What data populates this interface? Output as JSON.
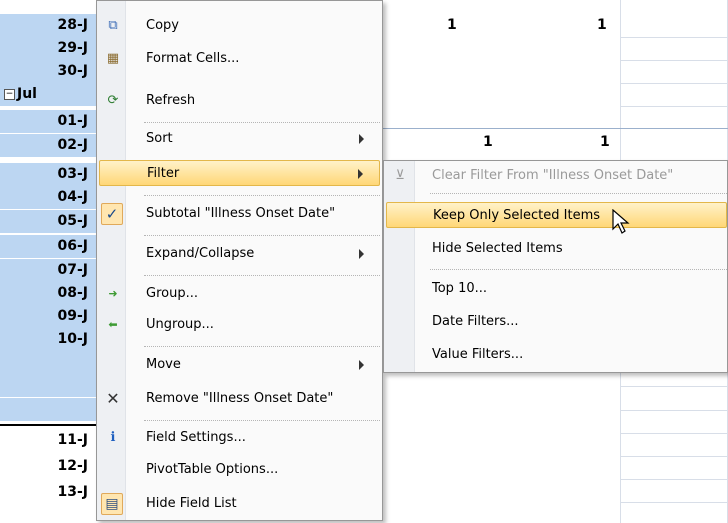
{
  "sheet": {
    "rows": [
      {
        "label": "28-J",
        "selected": true
      },
      {
        "label": "29-J",
        "selected": true
      },
      {
        "label": "30-J",
        "selected": true
      },
      {
        "label": "Jul",
        "selected": true,
        "group": true,
        "expander": "−"
      },
      {
        "label": "01-J",
        "selected": true
      },
      {
        "label": "02-J",
        "selected": true
      },
      {
        "label": "03-J",
        "selected": true
      },
      {
        "label": "04-J",
        "selected": true
      },
      {
        "label": "05-J",
        "selected": true
      },
      {
        "label": "06-J",
        "selected": true
      },
      {
        "label": "07-J",
        "selected": true
      },
      {
        "label": "08-J",
        "selected": true
      },
      {
        "label": "09-J",
        "selected": true
      },
      {
        "label": "10-J",
        "selected": true
      },
      {
        "label": "11-J",
        "selected": false
      },
      {
        "label": "12-J",
        "selected": false
      },
      {
        "label": "13-J",
        "selected": false
      }
    ],
    "values": {
      "row1_a": "1",
      "row1_b": "1",
      "row2_a": "1",
      "row2_b": "1"
    }
  },
  "menu": {
    "items": [
      {
        "label": "Copy",
        "icon": "copy-icon",
        "glyph": "⧉"
      },
      {
        "label": "Format Cells...",
        "icon": "format-cells-icon",
        "glyph": "▦"
      },
      {
        "label": "Refresh",
        "icon": "refresh-icon",
        "glyph": "⟳"
      },
      {
        "label": "Sort",
        "submenu": true
      },
      {
        "label": "Filter",
        "submenu": true,
        "highlighted": true
      },
      {
        "label": "Subtotal \"Illness Onset Date\"",
        "checked": true,
        "check_glyph": "✓"
      },
      {
        "label": "Expand/Collapse",
        "submenu": true
      },
      {
        "label": "Group...",
        "icon": "group-arrow-icon",
        "glyph": "➜"
      },
      {
        "label": "Ungroup...",
        "icon": "ungroup-arrow-icon",
        "glyph": "⬅"
      },
      {
        "label": "Move",
        "submenu": true
      },
      {
        "label": "Remove \"Illness Onset Date\"",
        "icon": "remove-x-icon",
        "glyph": "✕"
      },
      {
        "label": "Field Settings...",
        "icon": "field-settings-icon",
        "glyph": "ℹ"
      },
      {
        "label": "PivotTable Options..."
      },
      {
        "label": "Hide Field List",
        "icon": "field-list-icon",
        "glyph": "▤"
      }
    ]
  },
  "submenu": {
    "items": [
      {
        "label": "Clear Filter From \"Illness Onset Date\"",
        "disabled": true,
        "icon": "clear-filter-icon",
        "glyph": "⊻"
      },
      {
        "label": "Keep Only Selected Items",
        "highlighted": true
      },
      {
        "label": "Hide Selected Items"
      },
      {
        "label": "Top 10..."
      },
      {
        "label": "Date Filters..."
      },
      {
        "label": "Value Filters..."
      }
    ]
  },
  "colors": {
    "selection": "#bcd6f2",
    "highlight": "#ffd777",
    "menu_border": "#979797"
  }
}
